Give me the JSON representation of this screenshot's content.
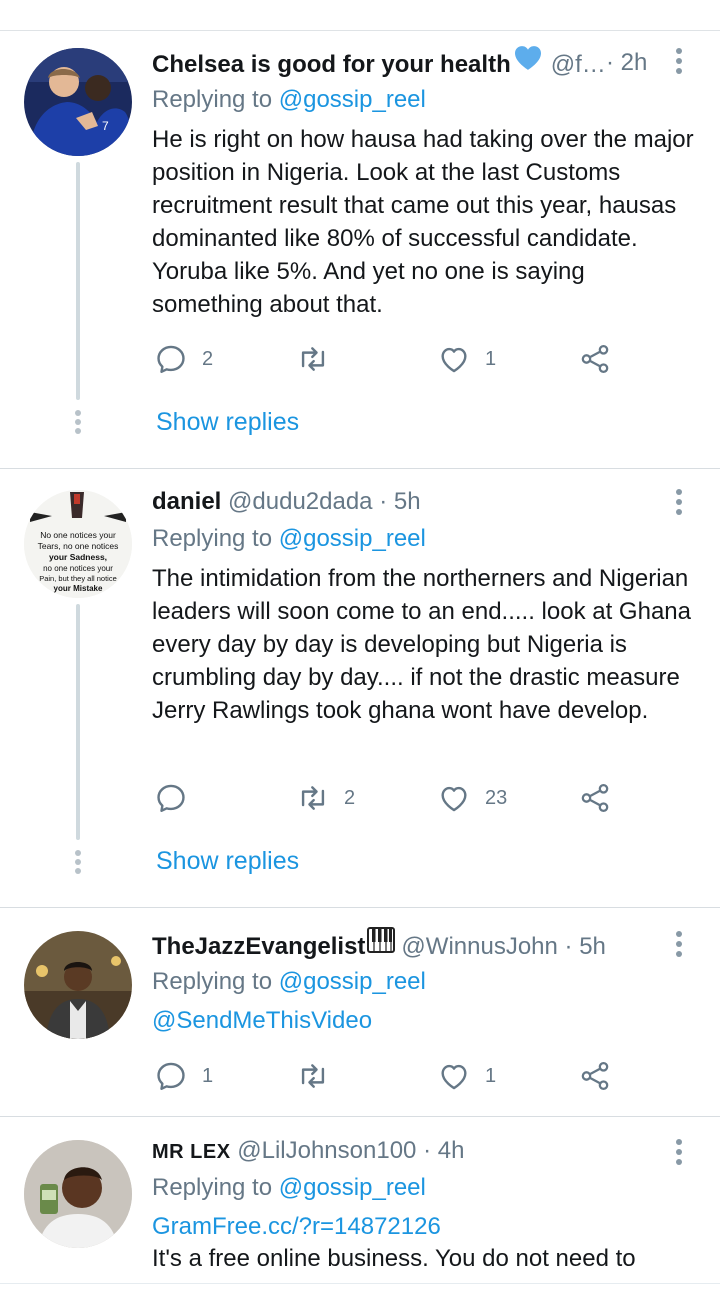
{
  "replying_prefix": "Replying to",
  "show_replies_label": "Show replies",
  "tweets": [
    {
      "name": "Chelsea is good for your health",
      "handle": "@f…",
      "time": "· 2h",
      "reply_to": "@gossip_reel",
      "text": "He is right on how hausa had taking over the major position in Nigeria. Look at the last Customs recruitment result that came out this year,  hausas dominanted like 80% of successful candidate. Yoruba like 5%. And yet no one is saying something about that.",
      "replies": "2",
      "retweets": "",
      "likes": "1"
    },
    {
      "name": "daniel",
      "handle": "@dudu2dada",
      "time": "· 5h",
      "reply_to": "@gossip_reel",
      "text": "The intimidation from the northerners and Nigerian leaders will soon come to an end..... look at Ghana every day by day is developing but Nigeria is crumbling day by day.... if not the drastic measure Jerry Rawlings took ghana wont have develop.",
      "replies": "",
      "retweets": "2",
      "likes": "23",
      "avatar_text": [
        "No one notices your",
        "Tears, no one notices",
        "your Sadness,",
        "no one notices your",
        "Pain, but they all notice",
        "your Mistake"
      ]
    },
    {
      "name": "TheJazzEvangelist",
      "handle": "@WinnusJohn",
      "time": "· 5h",
      "reply_to": "@gossip_reel",
      "link": "@SendMeThisVideo",
      "replies": "1",
      "retweets": "",
      "likes": "1"
    },
    {
      "name": "MR LEX",
      "handle": "@LilJohnson100",
      "time": "· 4h",
      "reply_to": "@gossip_reel",
      "link": "GramFree.cc/?r=14872126",
      "text": "It's a free online business. You do not need to"
    }
  ],
  "icons": {
    "reply": "reply-icon",
    "retweet": "retweet-icon",
    "like": "heart-icon",
    "share": "share-icon",
    "more": "more-vertical-icon",
    "heart_emoji": "blue-heart-emoji",
    "piano_emoji": "piano-emoji"
  },
  "colors": {
    "link": "#1b95e0",
    "secondary_text": "#657786",
    "thread_line": "#cfd9de"
  }
}
